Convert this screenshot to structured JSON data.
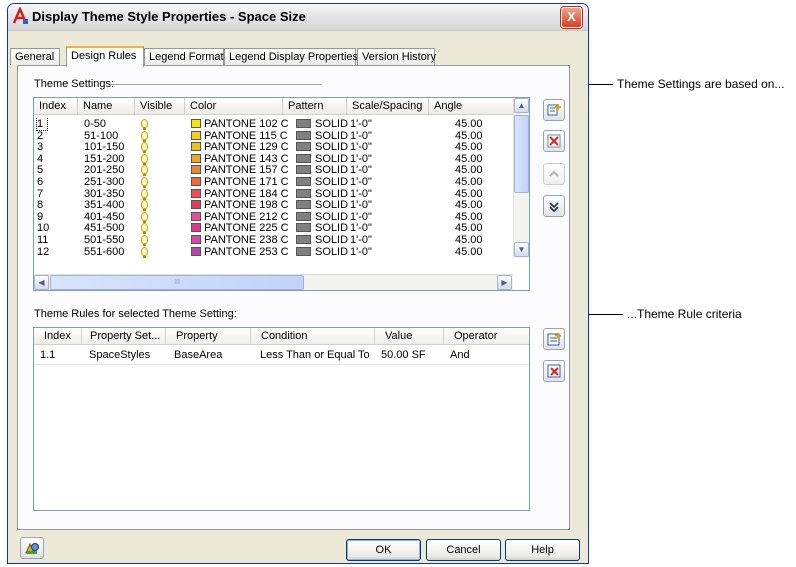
{
  "dialog": {
    "title": "Display Theme Style Properties - Space Size",
    "close_label": "X"
  },
  "tabs": [
    {
      "label": "General",
      "active": false
    },
    {
      "label": "Design Rules",
      "active": true
    },
    {
      "label": "Legend Format",
      "active": false
    },
    {
      "label": "Legend Display Properties",
      "active": false
    },
    {
      "label": "Version History",
      "active": false
    }
  ],
  "theme_settings": {
    "label": "Theme Settings:",
    "columns": [
      "Index",
      "Name",
      "Visible",
      "Color",
      "Pattern",
      "Scale/Spacing",
      "Angle"
    ],
    "rows": [
      {
        "index": "1",
        "name": "0-50",
        "color_name": "PANTONE 102 C",
        "color": "#f7e600",
        "pattern": "SOLID",
        "scale": "1'-0\"",
        "angle": "45.00"
      },
      {
        "index": "2",
        "name": "51-100",
        "color_name": "PANTONE 115 C",
        "color": "#f2d21c",
        "pattern": "SOLID",
        "scale": "1'-0\"",
        "angle": "45.00"
      },
      {
        "index": "3",
        "name": "101-150",
        "color_name": "PANTONE 129 C",
        "color": "#edc01e",
        "pattern": "SOLID",
        "scale": "1'-0\"",
        "angle": "45.00"
      },
      {
        "index": "4",
        "name": "151-200",
        "color_name": "PANTONE 143 C",
        "color": "#eba62a",
        "pattern": "SOLID",
        "scale": "1'-0\"",
        "angle": "45.00"
      },
      {
        "index": "5",
        "name": "201-250",
        "color_name": "PANTONE 157 C",
        "color": "#e8863a",
        "pattern": "SOLID",
        "scale": "1'-0\"",
        "angle": "45.00"
      },
      {
        "index": "6",
        "name": "251-300",
        "color_name": "PANTONE 171 C",
        "color": "#f26538",
        "pattern": "SOLID",
        "scale": "1'-0\"",
        "angle": "45.00"
      },
      {
        "index": "7",
        "name": "301-350",
        "color_name": "PANTONE 184 C",
        "color": "#ee4e5a",
        "pattern": "SOLID",
        "scale": "1'-0\"",
        "angle": "45.00"
      },
      {
        "index": "8",
        "name": "351-400",
        "color_name": "PANTONE 198 C",
        "color": "#e13a5e",
        "pattern": "SOLID",
        "scale": "1'-0\"",
        "angle": "45.00"
      },
      {
        "index": "9",
        "name": "401-450",
        "color_name": "PANTONE 212 C",
        "color": "#ea4e90",
        "pattern": "SOLID",
        "scale": "1'-0\"",
        "angle": "45.00"
      },
      {
        "index": "10",
        "name": "451-500",
        "color_name": "PANTONE 225 C",
        "color": "#e2358a",
        "pattern": "SOLID",
        "scale": "1'-0\"",
        "angle": "45.00"
      },
      {
        "index": "11",
        "name": "501-550",
        "color_name": "PANTONE 238 C",
        "color": "#d34aa8",
        "pattern": "SOLID",
        "scale": "1'-0\"",
        "angle": "45.00"
      },
      {
        "index": "12",
        "name": "551-600",
        "color_name": "PANTONE 253 C",
        "color": "#b04aa8",
        "pattern": "SOLID",
        "scale": "1'-0\"",
        "angle": "45.00"
      }
    ],
    "hscroll_thumb": "III"
  },
  "theme_rules": {
    "label": "Theme Rules for selected Theme Setting:",
    "columns": [
      "Index",
      "Property Set...",
      "Property",
      "Condition",
      "Value",
      "Operator"
    ],
    "rows": [
      {
        "index": "1.1",
        "property_set": "SpaceStyles",
        "property": "BaseArea",
        "condition": "Less Than or Equal To",
        "value": "50.00 SF",
        "operator": "And"
      }
    ]
  },
  "buttons": {
    "ok": "OK",
    "cancel": "Cancel",
    "help": "Help"
  },
  "callouts": {
    "theme_settings": "Theme Settings are based on...",
    "theme_rule": "...Theme Rule criteria"
  }
}
